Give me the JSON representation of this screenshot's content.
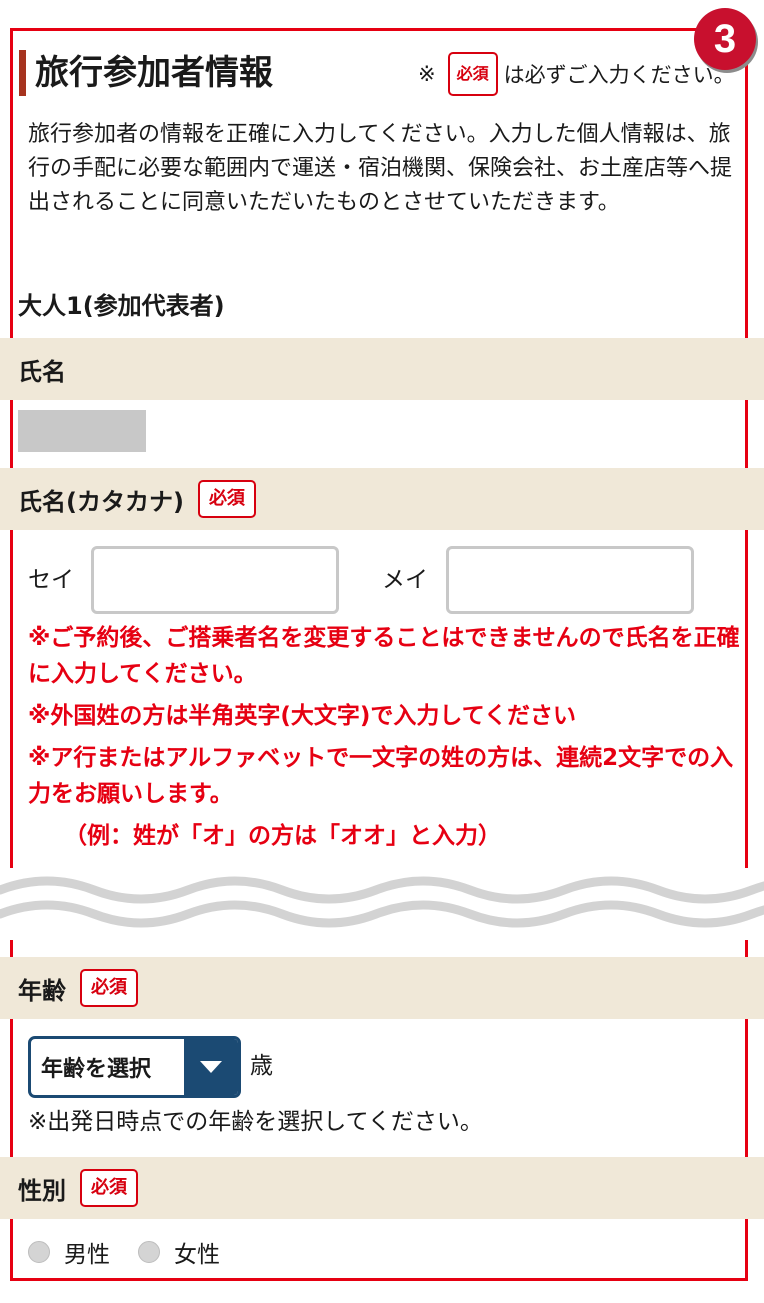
{
  "step": {
    "number": "3"
  },
  "section": {
    "title": "旅行参加者情報",
    "required_note": {
      "mark": "※",
      "badge": "必須",
      "text": "は必ずご入力ください。"
    },
    "intro": "旅行参加者の情報を正確に入力してください。入力した個人情報は、旅行の手配に必要な範囲内で運送・宿泊機関、保険会社、お土産店等へ提出されることに同意いただいたものとさせていただきます。"
  },
  "participant": {
    "heading": "大人1(参加代表者)",
    "name": {
      "label": "氏名"
    },
    "kana": {
      "label": "氏名(カタカナ)",
      "badge": "必須",
      "sei_label": "セイ",
      "mei_label": "メイ",
      "sei_value": "",
      "mei_value": ""
    },
    "warnings": [
      "※ご予約後、ご搭乗者名を変更することはできませんので氏名を正確に入力してください。",
      "※外国姓の方は半角英字(大文字)で入力してください",
      "※ア行またはアルファベットで一文字の姓の方は、連続2文字での入力をお願いします。",
      "（例：姓が「オ」の方は「オオ」と入力）"
    ],
    "age": {
      "label": "年齢",
      "badge": "必須",
      "select_value": "年齢を選択",
      "unit": "歳",
      "note": "※出発日時点での年齢を選択してください。"
    },
    "gender": {
      "label": "性別",
      "badge": "必須",
      "options": [
        "男性",
        "女性"
      ]
    }
  },
  "colors": {
    "accent_red": "#e60012",
    "band_beige": "#f0e8d8",
    "title_bar": "#a6331f",
    "select_navy": "#1b4a73"
  },
  "icons": [
    "dropdown-arrow-icon",
    "wave-divider-icon"
  ]
}
